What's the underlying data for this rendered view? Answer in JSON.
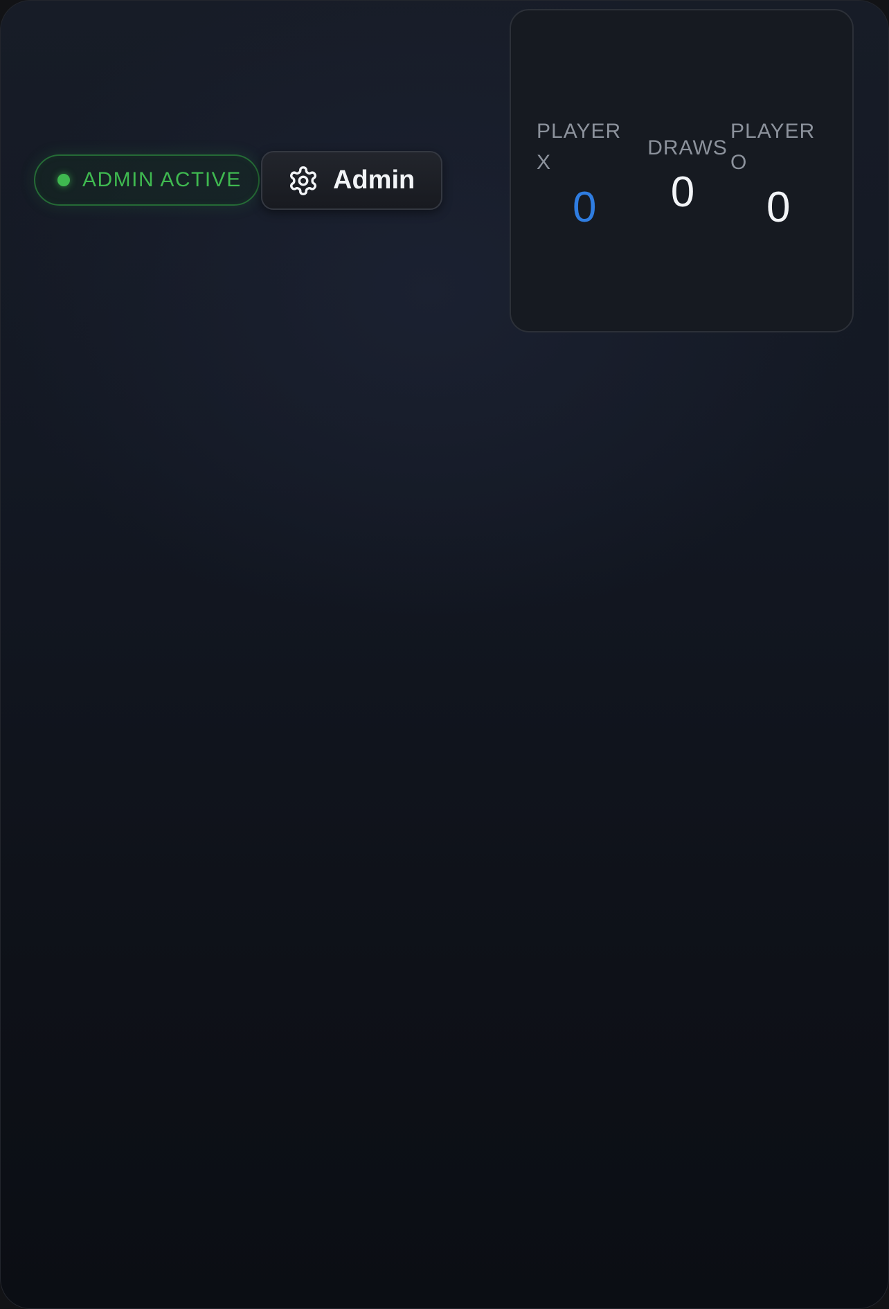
{
  "admin_status": {
    "label": "ADMIN ACTIVE",
    "color": "#3fb950"
  },
  "admin_button": {
    "label": "Admin",
    "icon": "gear-icon"
  },
  "scoreboard": {
    "player_x": {
      "label": "PLAYER X",
      "score": "0",
      "color": "#2f7de1"
    },
    "draws": {
      "label": "DRAWS",
      "score": "0",
      "color": "#f2f4f7"
    },
    "player_o": {
      "label": "PLAYER O",
      "score": "0",
      "color": "#f2f4f7"
    }
  }
}
